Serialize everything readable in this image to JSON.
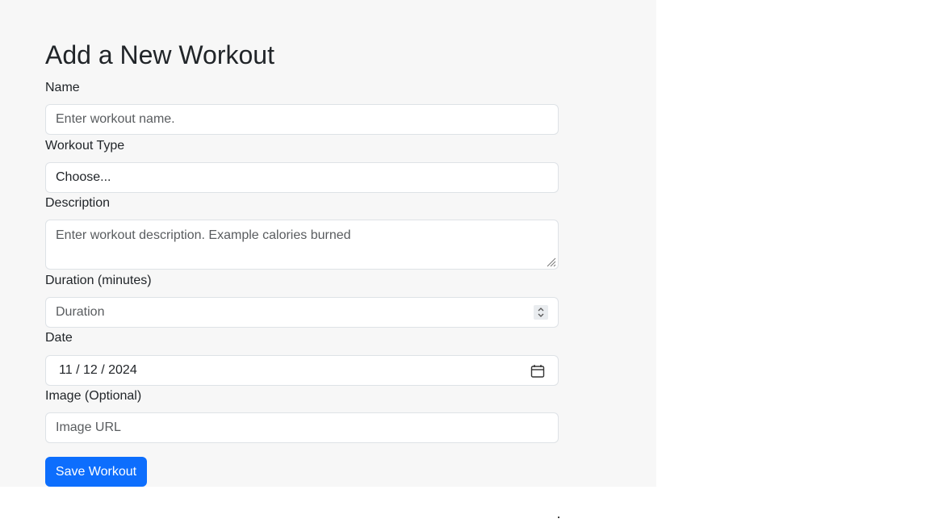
{
  "form": {
    "title": "Add a New Workout",
    "name": {
      "label": "Name",
      "placeholder": "Enter workout name."
    },
    "workout_type": {
      "label": "Workout Type",
      "value": "Choose..."
    },
    "description": {
      "label": "Description",
      "placeholder": "Enter workout description. Example calories burned"
    },
    "duration": {
      "label": "Duration (minutes)",
      "placeholder": "Duration"
    },
    "date": {
      "label": "Date",
      "month": "11",
      "day": "12",
      "year": "2024",
      "separator": "/"
    },
    "image": {
      "label": "Image (Optional)",
      "placeholder": "Image URL"
    },
    "save_label": "Save Workout"
  },
  "colors": {
    "panel_bg": "#f7f7f7",
    "primary": "#0d6efd",
    "border": "#dee2e6"
  }
}
